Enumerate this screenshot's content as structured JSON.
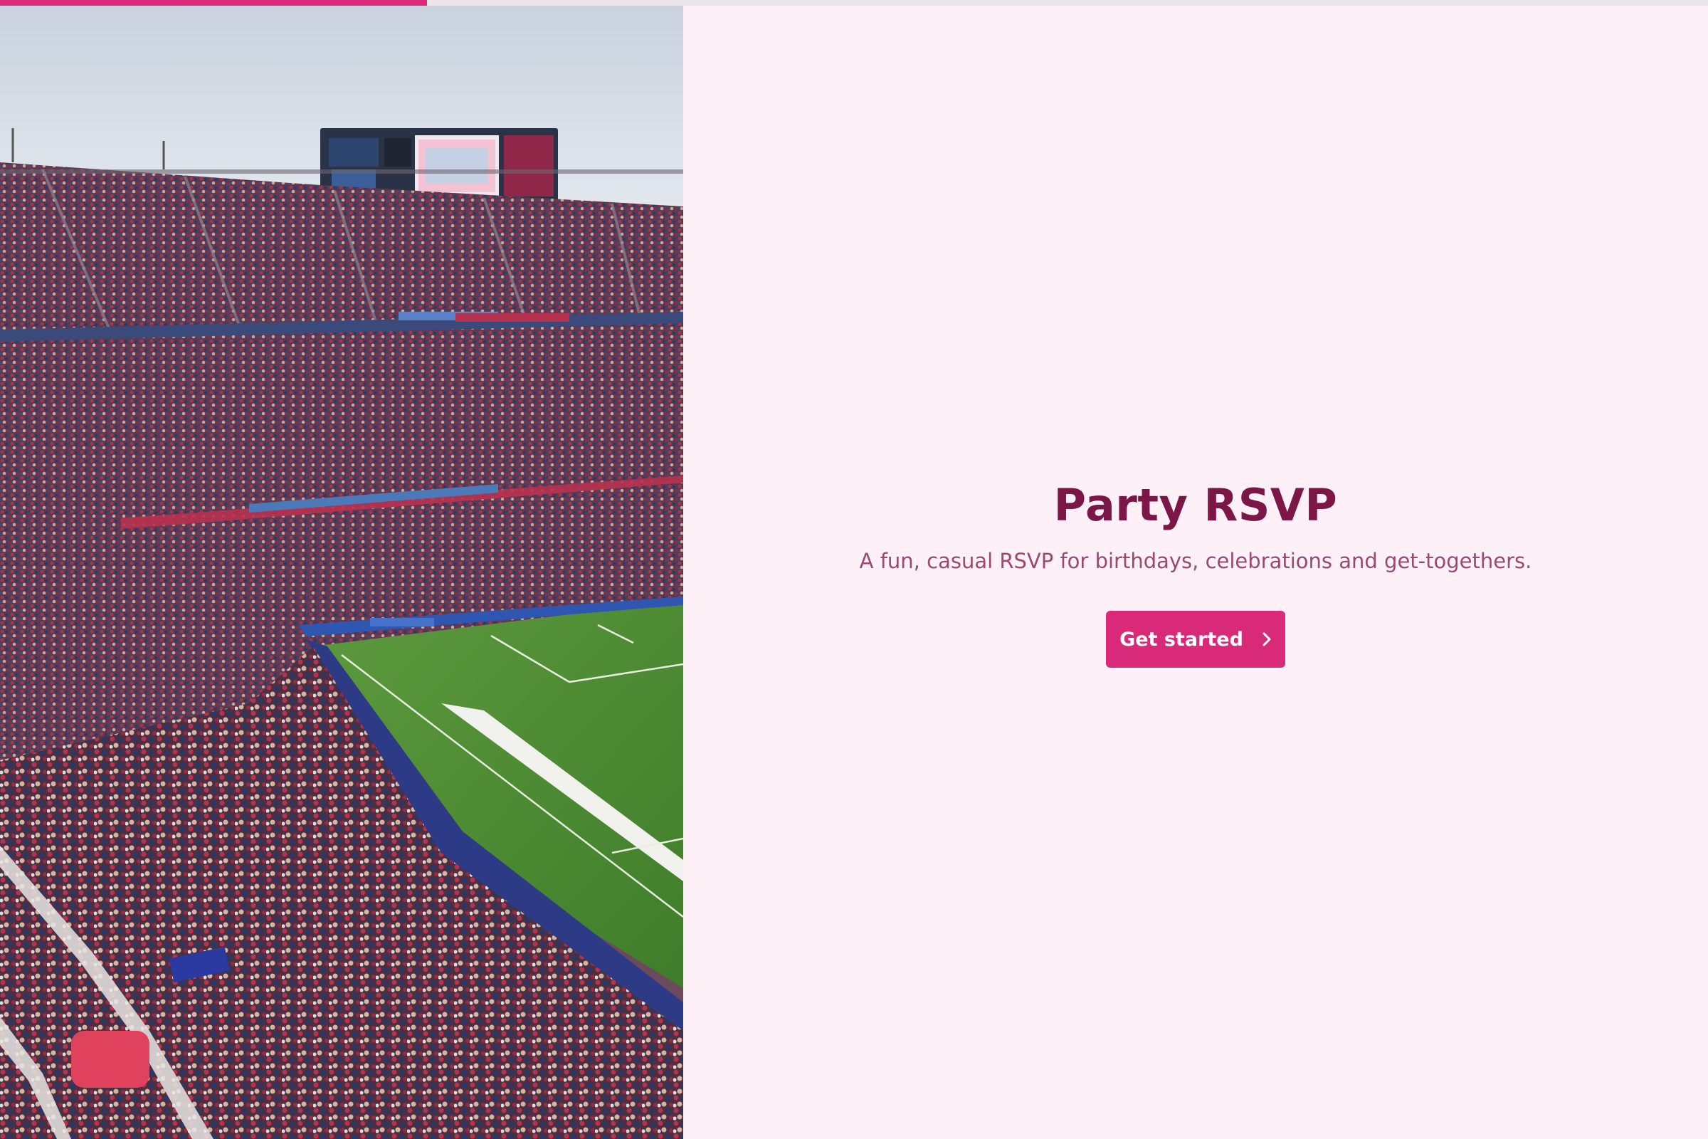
{
  "progress": {
    "value": 0.25,
    "color": "#d92a79"
  },
  "hero": {
    "image_description_icon": "stadium-photo"
  },
  "main": {
    "title": "Party RSVP",
    "subtitle": "A fun, casual RSVP for birthdays, celebrations and get-togethers.",
    "cta_label": "Get started",
    "cta_icon": "chevron-right-icon"
  },
  "colors": {
    "accent": "#d92a79",
    "title": "#7c1646",
    "subtitle": "#9a4a70",
    "background": "#fdf0f6"
  }
}
